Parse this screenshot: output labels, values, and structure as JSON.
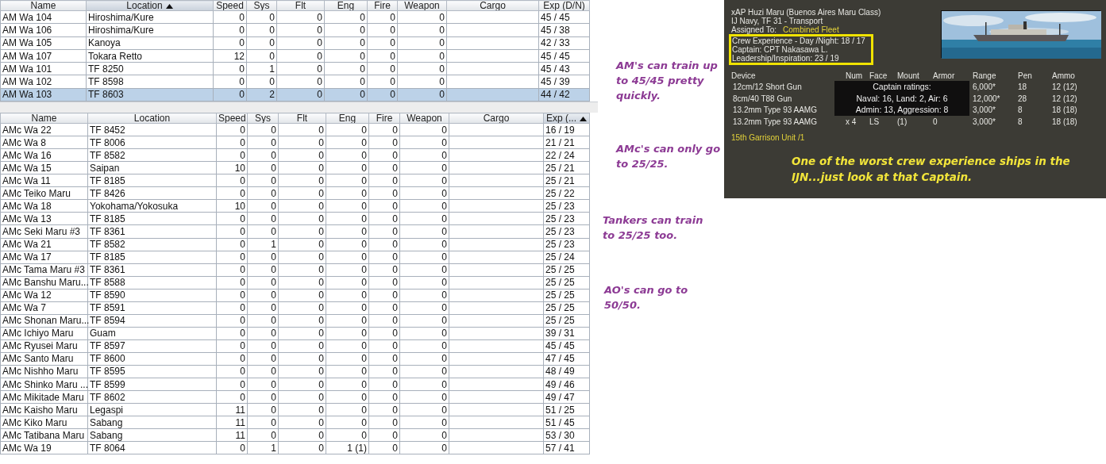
{
  "tables": [
    {
      "columns": [
        {
          "label": "Name",
          "sorted": false
        },
        {
          "label": "Location",
          "sorted": true
        },
        {
          "label": "Speed",
          "sorted": false
        },
        {
          "label": "Sys",
          "sorted": false
        },
        {
          "label": "Flt",
          "sorted": false
        },
        {
          "label": "Eng",
          "sorted": false
        },
        {
          "label": "Fire",
          "sorted": false
        },
        {
          "label": "Weapon",
          "sorted": false
        },
        {
          "label": "Cargo",
          "sorted": false
        },
        {
          "label": "Exp (D/N)",
          "sorted": false
        }
      ],
      "rows": [
        {
          "name": "AM Wa 104",
          "location": "Hiroshima/Kure",
          "speed": "0",
          "sys": "0",
          "flt": "0",
          "eng": "0",
          "fire": "0",
          "weapon": "0",
          "exp": "45 / 45",
          "selected": false
        },
        {
          "name": "AM Wa 106",
          "location": "Hiroshima/Kure",
          "speed": "0",
          "sys": "0",
          "flt": "0",
          "eng": "0",
          "fire": "0",
          "weapon": "0",
          "exp": "45 / 38",
          "selected": false
        },
        {
          "name": "AM Wa 105",
          "location": "Kanoya",
          "speed": "0",
          "sys": "0",
          "flt": "0",
          "eng": "0",
          "fire": "0",
          "weapon": "0",
          "exp": "42 / 33",
          "selected": false
        },
        {
          "name": "AM Wa 107",
          "location": "Tokara Retto",
          "speed": "12",
          "sys": "0",
          "flt": "0",
          "eng": "0",
          "fire": "0",
          "weapon": "0",
          "exp": "45 / 45",
          "selected": false
        },
        {
          "name": "AM Wa 101",
          "location": "TF 8250",
          "speed": "0",
          "sys": "1",
          "flt": "0",
          "eng": "0",
          "fire": "0",
          "weapon": "0",
          "exp": "45 / 43",
          "selected": false
        },
        {
          "name": "AM Wa 102",
          "location": "TF 8598",
          "speed": "0",
          "sys": "0",
          "flt": "0",
          "eng": "0",
          "fire": "0",
          "weapon": "0",
          "exp": "45 / 39",
          "selected": false
        },
        {
          "name": "AM Wa 103",
          "location": "TF 8603",
          "speed": "0",
          "sys": "2",
          "flt": "0",
          "eng": "0",
          "fire": "0",
          "weapon": "0",
          "exp": "44 / 42",
          "selected": true
        }
      ]
    },
    {
      "columns": [
        {
          "label": "Name",
          "sorted": false
        },
        {
          "label": "Location",
          "sorted": false
        },
        {
          "label": "Speed",
          "sorted": false
        },
        {
          "label": "Sys",
          "sorted": false
        },
        {
          "label": "Flt",
          "sorted": false
        },
        {
          "label": "Eng",
          "sorted": false
        },
        {
          "label": "Fire",
          "sorted": false
        },
        {
          "label": "Weapon",
          "sorted": false
        },
        {
          "label": "Cargo",
          "sorted": false
        },
        {
          "label": "Exp (...",
          "sorted": true
        }
      ],
      "rows": [
        {
          "name": "AMc Wa 22",
          "location": "TF 8452",
          "speed": "0",
          "sys": "0",
          "flt": "0",
          "eng": "0",
          "fire": "0",
          "weapon": "0",
          "exp": "16 / 19",
          "selected": false
        },
        {
          "name": "AMc Wa 8",
          "location": "TF 8006",
          "speed": "0",
          "sys": "0",
          "flt": "0",
          "eng": "0",
          "fire": "0",
          "weapon": "0",
          "exp": "21 / 21",
          "selected": false
        },
        {
          "name": "AMc Wa 16",
          "location": "TF 8582",
          "speed": "0",
          "sys": "0",
          "flt": "0",
          "eng": "0",
          "fire": "0",
          "weapon": "0",
          "exp": "22 / 24",
          "selected": false
        },
        {
          "name": "AMc Wa 15",
          "location": "Saipan",
          "speed": "10",
          "sys": "0",
          "flt": "0",
          "eng": "0",
          "fire": "0",
          "weapon": "0",
          "exp": "25 / 21",
          "selected": false
        },
        {
          "name": "AMc Wa 11",
          "location": "TF 8185",
          "speed": "0",
          "sys": "0",
          "flt": "0",
          "eng": "0",
          "fire": "0",
          "weapon": "0",
          "exp": "25 / 21",
          "selected": false
        },
        {
          "name": "AMc Teiko Maru",
          "location": "TF 8426",
          "speed": "0",
          "sys": "0",
          "flt": "0",
          "eng": "0",
          "fire": "0",
          "weapon": "0",
          "exp": "25 / 22",
          "selected": false
        },
        {
          "name": "AMc Wa 18",
          "location": "Yokohama/Yokosuka",
          "speed": "10",
          "sys": "0",
          "flt": "0",
          "eng": "0",
          "fire": "0",
          "weapon": "0",
          "exp": "25 / 23",
          "selected": false
        },
        {
          "name": "AMc Wa 13",
          "location": "TF 8185",
          "speed": "0",
          "sys": "0",
          "flt": "0",
          "eng": "0",
          "fire": "0",
          "weapon": "0",
          "exp": "25 / 23",
          "selected": false
        },
        {
          "name": "AMc Seki Maru #3",
          "location": "TF 8361",
          "speed": "0",
          "sys": "0",
          "flt": "0",
          "eng": "0",
          "fire": "0",
          "weapon": "0",
          "exp": "25 / 23",
          "selected": false
        },
        {
          "name": "AMc Wa 21",
          "location": "TF 8582",
          "speed": "0",
          "sys": "1",
          "flt": "0",
          "eng": "0",
          "fire": "0",
          "weapon": "0",
          "exp": "25 / 23",
          "selected": false
        },
        {
          "name": "AMc Wa 17",
          "location": "TF 8185",
          "speed": "0",
          "sys": "0",
          "flt": "0",
          "eng": "0",
          "fire": "0",
          "weapon": "0",
          "exp": "25 / 24",
          "selected": false
        },
        {
          "name": "AMc Tama Maru #3",
          "location": "TF 8361",
          "speed": "0",
          "sys": "0",
          "flt": "0",
          "eng": "0",
          "fire": "0",
          "weapon": "0",
          "exp": "25 / 25",
          "selected": false
        },
        {
          "name": "AMc Banshu Maru...",
          "location": "TF 8588",
          "speed": "0",
          "sys": "0",
          "flt": "0",
          "eng": "0",
          "fire": "0",
          "weapon": "0",
          "exp": "25 / 25",
          "selected": false
        },
        {
          "name": "AMc Wa 12",
          "location": "TF 8590",
          "speed": "0",
          "sys": "0",
          "flt": "0",
          "eng": "0",
          "fire": "0",
          "weapon": "0",
          "exp": "25 / 25",
          "selected": false
        },
        {
          "name": "AMc Wa 7",
          "location": "TF 8591",
          "speed": "0",
          "sys": "0",
          "flt": "0",
          "eng": "0",
          "fire": "0",
          "weapon": "0",
          "exp": "25 / 25",
          "selected": false
        },
        {
          "name": "AMc Shonan Maru...",
          "location": "TF 8594",
          "speed": "0",
          "sys": "0",
          "flt": "0",
          "eng": "0",
          "fire": "0",
          "weapon": "0",
          "exp": "25 / 25",
          "selected": false
        },
        {
          "name": "AMc Ichiyo Maru",
          "location": "Guam",
          "speed": "0",
          "sys": "0",
          "flt": "0",
          "eng": "0",
          "fire": "0",
          "weapon": "0",
          "exp": "39 / 31",
          "selected": false
        },
        {
          "name": "AMc Ryusei Maru",
          "location": "TF 8597",
          "speed": "0",
          "sys": "0",
          "flt": "0",
          "eng": "0",
          "fire": "0",
          "weapon": "0",
          "exp": "45 / 45",
          "selected": false
        },
        {
          "name": "AMc Santo Maru",
          "location": "TF 8600",
          "speed": "0",
          "sys": "0",
          "flt": "0",
          "eng": "0",
          "fire": "0",
          "weapon": "0",
          "exp": "47 / 45",
          "selected": false
        },
        {
          "name": "AMc Nishho Maru",
          "location": "TF 8595",
          "speed": "0",
          "sys": "0",
          "flt": "0",
          "eng": "0",
          "fire": "0",
          "weapon": "0",
          "exp": "48 / 49",
          "selected": false
        },
        {
          "name": "AMc Shinko Maru ...",
          "location": "TF 8599",
          "speed": "0",
          "sys": "0",
          "flt": "0",
          "eng": "0",
          "fire": "0",
          "weapon": "0",
          "exp": "49 / 46",
          "selected": false
        },
        {
          "name": "AMc Mikitade Maru",
          "location": "TF 8602",
          "speed": "0",
          "sys": "0",
          "flt": "0",
          "eng": "0",
          "fire": "0",
          "weapon": "0",
          "exp": "49 / 47",
          "selected": false
        },
        {
          "name": "AMc Kaisho Maru",
          "location": "Legaspi",
          "speed": "11",
          "sys": "0",
          "flt": "0",
          "eng": "0",
          "fire": "0",
          "weapon": "0",
          "exp": "51 / 25",
          "selected": false
        },
        {
          "name": "AMc Kiko Maru",
          "location": "Sabang",
          "speed": "11",
          "sys": "0",
          "flt": "0",
          "eng": "0",
          "fire": "0",
          "weapon": "0",
          "exp": "51 / 45",
          "selected": false
        },
        {
          "name": "AMc Tatibana Maru",
          "location": "Sabang",
          "speed": "11",
          "sys": "0",
          "flt": "0",
          "eng": "0",
          "fire": "0",
          "weapon": "0",
          "exp": "53 / 30",
          "selected": false
        },
        {
          "name": "AMc Wa 19",
          "location": "TF 8064",
          "speed": "0",
          "sys": "1",
          "flt": "0",
          "eng": "1 (1)",
          "fire": "0",
          "weapon": "0",
          "exp": "57 / 41",
          "selected": false
        }
      ]
    }
  ],
  "notes": [
    {
      "lines": [
        "AM's can train up",
        "to 45/45 pretty",
        "quickly."
      ]
    },
    {
      "lines": [
        "AMc's can only go",
        "to 25/25."
      ]
    },
    {
      "lines": [
        "Tankers can train",
        "to 25/25 too."
      ]
    },
    {
      "lines": [
        "AO's can go to",
        "50/50."
      ]
    }
  ],
  "ship_panel": {
    "header_lines": [
      "xAP Huzi Maru (Buenos Aires Maru Class)",
      "IJ Navy, TF 31 - Transport"
    ],
    "assigned": {
      "label": "Assigned To:",
      "value": "Combined Fleet"
    },
    "picture": {
      "kind": "picture"
    },
    "crew_box": {
      "highlighted": true,
      "lines": [
        "Crew Experience - Day /Night: 18 / 17",
        "Captain:  CPT Nakasawa L.",
        "Leadership/Inspiration: 23 / 19"
      ]
    },
    "devices": {
      "columns": [
        "Device",
        "Num",
        "Face",
        "Mount",
        "Armor",
        "Range",
        "Pen",
        "Ammo"
      ],
      "rows": [
        {
          "device": "12cm/12 Short Gun",
          "range": "6,000*",
          "pen": "18",
          "ammo": "12  (12)"
        },
        {
          "device": "8cm/40 T88 Gun",
          "range": "12,000*",
          "pen": "28",
          "ammo": "12  (12)"
        },
        {
          "device": "13.2mm Type 93 AAMG",
          "range": "3,000*",
          "pen": "8",
          "ammo": "18  (18)"
        },
        {
          "device": "13.2mm Type 93 AAMG",
          "num": "x 4",
          "face": "LS",
          "mount": "(1)",
          "armor": "0",
          "range": "3,000*",
          "pen": "8",
          "ammo": "18  (18)"
        }
      ]
    },
    "tooltip": {
      "lines": [
        "Captain ratings:",
        "Naval: 16, Land: 2, Air: 6",
        "Admin: 13, Aggression: 8"
      ]
    },
    "unit": "15th Garrison Unit /1",
    "comment": [
      "One of the worst crew experience ships in the",
      "IJN...just look at that Captain."
    ]
  }
}
